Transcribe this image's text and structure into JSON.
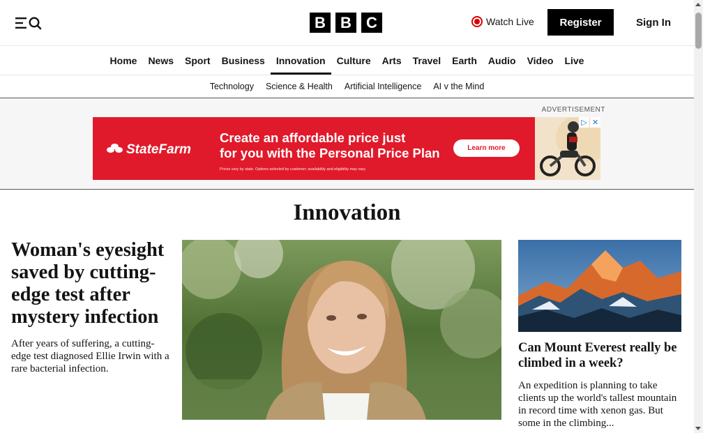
{
  "header": {
    "logo_letters": [
      "B",
      "B",
      "C"
    ],
    "watch_live_label": "Watch Live",
    "register_label": "Register",
    "sign_in_label": "Sign In",
    "menu_icon": "menu-search-icon",
    "live_icon": "live-radio-icon"
  },
  "nav": {
    "items": [
      "Home",
      "News",
      "Sport",
      "Business",
      "Innovation",
      "Culture",
      "Arts",
      "Travel",
      "Earth",
      "Audio",
      "Video",
      "Live"
    ],
    "active": "Innovation"
  },
  "subnav": {
    "items": [
      "Technology",
      "Science & Health",
      "Artificial Intelligence",
      "AI v the Mind"
    ]
  },
  "advertisement": {
    "label": "ADVERTISEMENT",
    "brand": "StateFarm",
    "headline_line1": "Create an affordable price just",
    "headline_line2": "for you with the Personal Price Plan",
    "fine_print": "Prices vary by state. Options selected by customer; availability and eligibility may vary.",
    "cta": "Learn more",
    "brand_color": "#e01a2b"
  },
  "page": {
    "title": "Innovation"
  },
  "lead_story": {
    "title": "Woman's eyesight saved by cutting-edge test after mystery infection",
    "description": "After years of suffering, a cutting-edge test diagnosed Ellie Irwin with a rare bacterial infection."
  },
  "side_story": {
    "title": "Can Mount Everest really be climbed in a week?",
    "description": "An expedition is planning to take clients up the world's tallest mountain in record time with xenon gas. But some in the climbing..."
  }
}
